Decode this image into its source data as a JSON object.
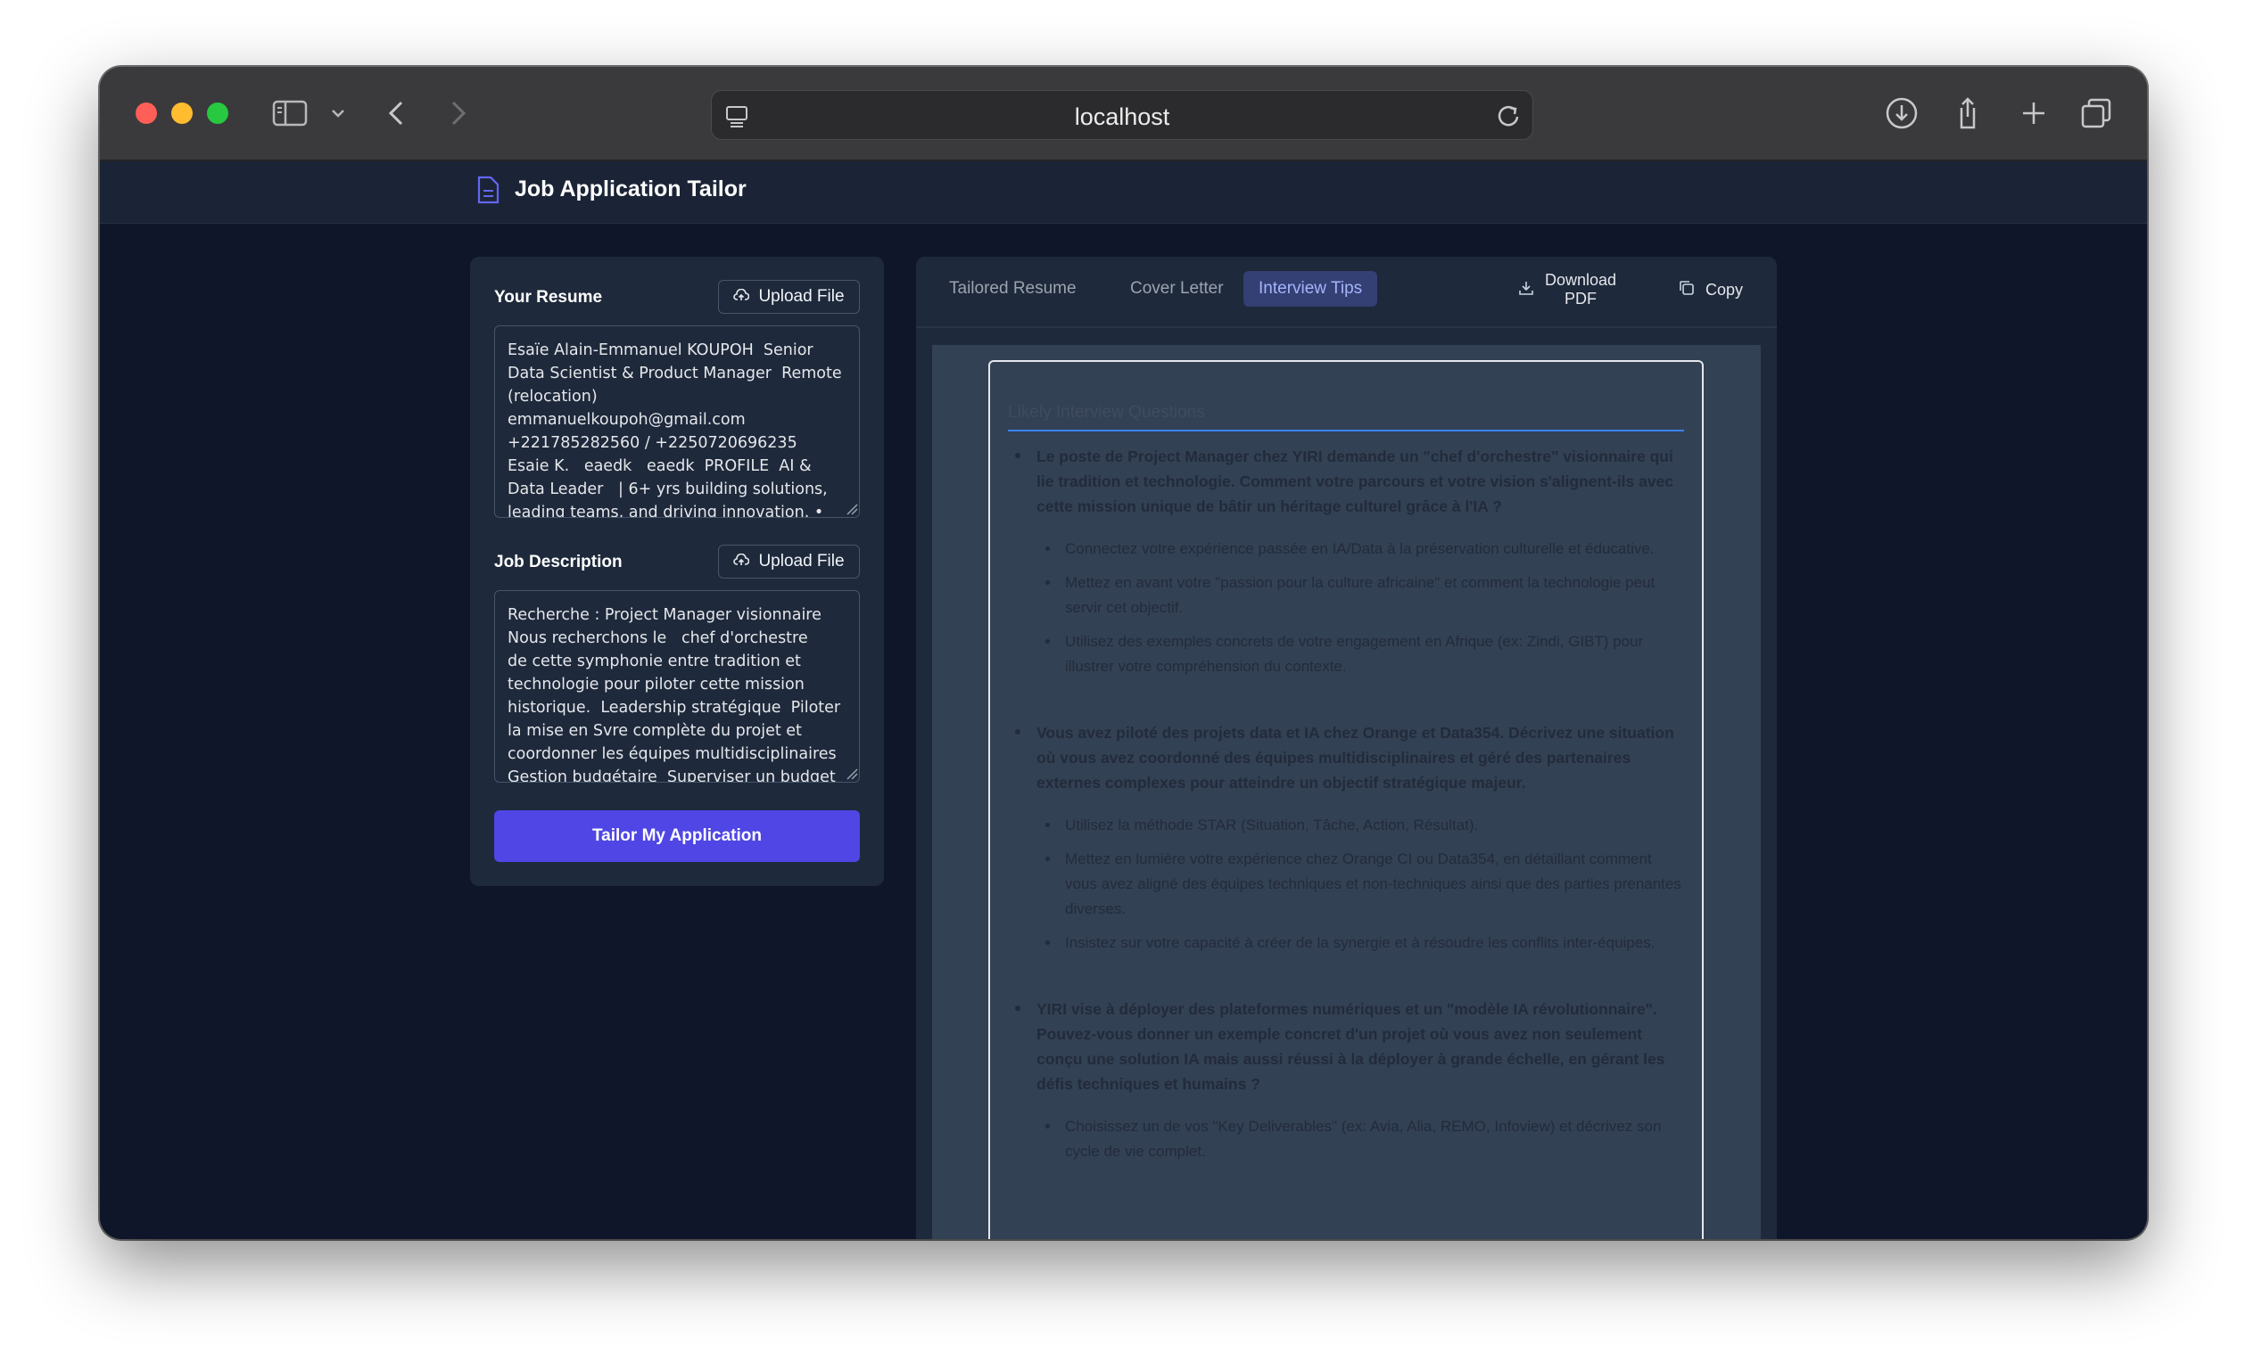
{
  "browser": {
    "url": "localhost"
  },
  "app": {
    "title": "Job Application Tailor"
  },
  "resume": {
    "label": "Your Resume",
    "upload_label": "Upload File",
    "value": "Esaïe Alain-Emmanuel KOUPOH  Senior\nData Scientist & Product Manager  Remote\n(relocation)\nemmanuelkoupoh@gmail.com\n+221785282560 / +2250720696235\nEsaie K.   eaedk   eaedk  PROFILE  AI &\nData Leader   | 6+ yrs building solutions,\nleading teams, and driving innovation. •"
  },
  "job": {
    "label": "Job Description",
    "upload_label": "Upload File",
    "value": "Recherche : Project Manager visionnaire\nNous recherchons le   chef d'orchestre\nde cette symphonie entre tradition et\ntechnologie pour piloter cette mission\nhistorique.  Leadership stratégique  Piloter\nla mise en Svre complète du projet et\ncoordonner les équipes multidisciplinaires\nGestion budgétaire  Superviser un budget"
  },
  "submit_label": "Tailor My Application",
  "tabs": [
    {
      "label": "Tailored Resume",
      "active": false
    },
    {
      "label": "Cover Letter",
      "active": false
    },
    {
      "label": "Interview Tips",
      "active": true
    }
  ],
  "actions": {
    "download_label_1": "Download",
    "download_label_2": "PDF",
    "copy_label": "Copy"
  },
  "preview": {
    "title": "Likely Interview Questions",
    "questions": [
      {
        "text": "Le poste de Project Manager chez YIRI demande un \"chef d'orchestre\" visionnaire qui lie tradition et technologie. Comment votre parcours et votre vision s'alignent-ils avec cette mission unique de bâtir un héritage culturel grâce à l'IA ?",
        "tips": [
          "Connectez votre expérience passée en IA/Data à la préservation culturelle et éducative.",
          "Mettez en avant votre \"passion pour la culture africaine\" et comment la technologie peut servir cet objectif.",
          "Utilisez des exemples concrets de votre engagement en Afrique (ex: Zindi, GIBT) pour illustrer votre compréhension du contexte."
        ]
      },
      {
        "text": "Vous avez piloté des projets data et IA chez Orange et Data354. Décrivez une situation où vous avez coordonné des équipes multidisciplinaires et géré des partenaires externes complexes pour atteindre un objectif stratégique majeur.",
        "tips": [
          "Utilisez la méthode STAR (Situation, Tâche, Action, Résultat).",
          "Mettez en lumière votre expérience chez Orange CI ou Data354, en détaillant comment vous avez aligné des équipes techniques et non-techniques ainsi que des parties prenantes diverses.",
          "Insistez sur votre capacité à créer de la synergie et à résoudre les conflits inter-équipes."
        ]
      },
      {
        "text": "YIRI vise à déployer des plateformes numériques et un \"modèle IA révolutionnaire\". Pouvez-vous donner un exemple concret d'un projet où vous avez non seulement conçu une solution IA mais aussi réussi à la déployer à grande échelle, en gérant les défis techniques et humains ?",
        "tips": [
          "Choisissez un de vos \"Key Deliverables\" (ex: Avia, Alia, REMO, Infoview) et décrivez son cycle de vie complet."
        ]
      }
    ]
  }
}
